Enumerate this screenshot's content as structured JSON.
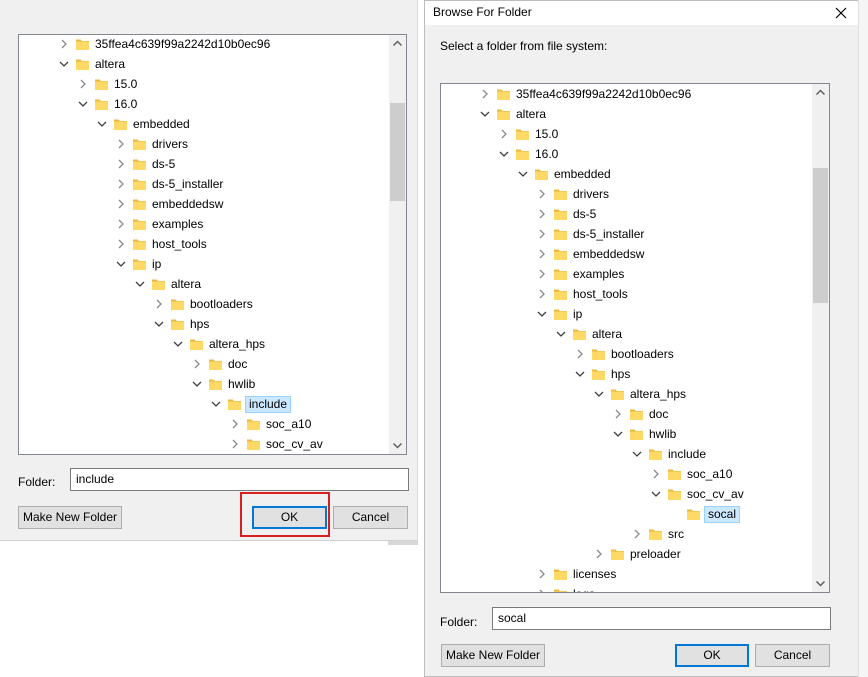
{
  "left_dialog": {
    "tree_items": [
      {
        "label": "35ffea4c639f99a2242d10b0ec96",
        "depth": 0,
        "state": "collapsed"
      },
      {
        "label": "altera",
        "depth": 0,
        "state": "expanded"
      },
      {
        "label": "15.0",
        "depth": 1,
        "state": "collapsed"
      },
      {
        "label": "16.0",
        "depth": 1,
        "state": "expanded"
      },
      {
        "label": "embedded",
        "depth": 2,
        "state": "expanded"
      },
      {
        "label": "drivers",
        "depth": 3,
        "state": "collapsed"
      },
      {
        "label": "ds-5",
        "depth": 3,
        "state": "collapsed"
      },
      {
        "label": "ds-5_installer",
        "depth": 3,
        "state": "collapsed"
      },
      {
        "label": "embeddedsw",
        "depth": 3,
        "state": "collapsed"
      },
      {
        "label": "examples",
        "depth": 3,
        "state": "collapsed"
      },
      {
        "label": "host_tools",
        "depth": 3,
        "state": "collapsed"
      },
      {
        "label": "ip",
        "depth": 3,
        "state": "expanded"
      },
      {
        "label": "altera",
        "depth": 4,
        "state": "expanded"
      },
      {
        "label": "bootloaders",
        "depth": 5,
        "state": "collapsed"
      },
      {
        "label": "hps",
        "depth": 5,
        "state": "expanded"
      },
      {
        "label": "altera_hps",
        "depth": 6,
        "state": "expanded"
      },
      {
        "label": "doc",
        "depth": 7,
        "state": "collapsed"
      },
      {
        "label": "hwlib",
        "depth": 7,
        "state": "expanded"
      },
      {
        "label": "include",
        "depth": 8,
        "state": "expanded",
        "selected": true
      },
      {
        "label": "soc_a10",
        "depth": 9,
        "state": "collapsed"
      },
      {
        "label": "soc_cv_av",
        "depth": 9,
        "state": "collapsed"
      }
    ],
    "folder_label": "Folder:",
    "folder_value": "include",
    "make_new_folder": "Make New Folder",
    "ok": "OK",
    "cancel": "Cancel",
    "scroll_fraction": 0.35
  },
  "right_dialog": {
    "title": "Browse For Folder",
    "instruction": "Select a folder from file system:",
    "tree_items": [
      {
        "label": "35ffea4c639f99a2242d10b0ec96",
        "depth": 0,
        "state": "collapsed"
      },
      {
        "label": "altera",
        "depth": 0,
        "state": "expanded"
      },
      {
        "label": "15.0",
        "depth": 1,
        "state": "collapsed"
      },
      {
        "label": "16.0",
        "depth": 1,
        "state": "expanded"
      },
      {
        "label": "embedded",
        "depth": 2,
        "state": "expanded"
      },
      {
        "label": "drivers",
        "depth": 3,
        "state": "collapsed"
      },
      {
        "label": "ds-5",
        "depth": 3,
        "state": "collapsed"
      },
      {
        "label": "ds-5_installer",
        "depth": 3,
        "state": "collapsed"
      },
      {
        "label": "embeddedsw",
        "depth": 3,
        "state": "collapsed"
      },
      {
        "label": "examples",
        "depth": 3,
        "state": "collapsed"
      },
      {
        "label": "host_tools",
        "depth": 3,
        "state": "collapsed"
      },
      {
        "label": "ip",
        "depth": 3,
        "state": "expanded"
      },
      {
        "label": "altera",
        "depth": 4,
        "state": "expanded"
      },
      {
        "label": "bootloaders",
        "depth": 5,
        "state": "collapsed"
      },
      {
        "label": "hps",
        "depth": 5,
        "state": "expanded"
      },
      {
        "label": "altera_hps",
        "depth": 6,
        "state": "expanded"
      },
      {
        "label": "doc",
        "depth": 7,
        "state": "collapsed"
      },
      {
        "label": "hwlib",
        "depth": 7,
        "state": "expanded"
      },
      {
        "label": "include",
        "depth": 8,
        "state": "expanded"
      },
      {
        "label": "soc_a10",
        "depth": 9,
        "state": "collapsed"
      },
      {
        "label": "soc_cv_av",
        "depth": 9,
        "state": "expanded"
      },
      {
        "label": "socal",
        "depth": 10,
        "state": "leaf",
        "selected": true
      },
      {
        "label": "src",
        "depth": 8,
        "state": "collapsed"
      },
      {
        "label": "preloader",
        "depth": 6,
        "state": "collapsed"
      },
      {
        "label": "licenses",
        "depth": 3,
        "state": "collapsed"
      },
      {
        "label": "logs",
        "depth": 3,
        "state": "collapsed"
      }
    ],
    "folder_label": "Folder:",
    "folder_value": "socal",
    "make_new_folder": "Make New Folder",
    "ok": "OK",
    "cancel": "Cancel",
    "scroll_fraction": 0.4
  },
  "colors": {
    "folder_fill": "#ffd966",
    "folder_tab": "#e8b840",
    "selection_bg": "#cce8ff",
    "selection_border": "#99d1ff",
    "default_button_border": "#0078d7",
    "highlight_box": "#d42020"
  }
}
